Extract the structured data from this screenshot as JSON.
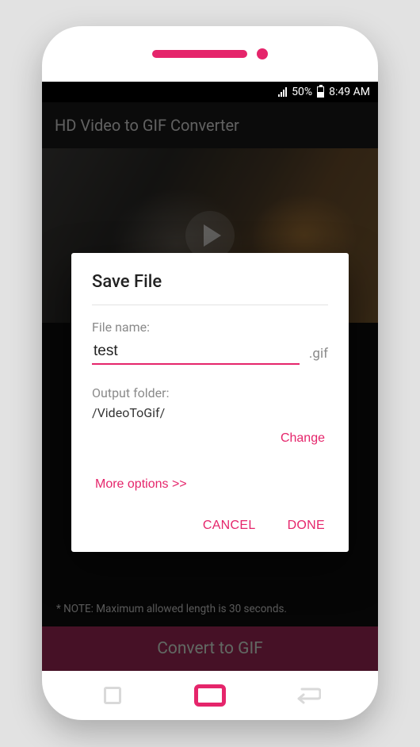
{
  "statusbar": {
    "battery": "50%",
    "time": "8:49 AM"
  },
  "appbar": {
    "title": "HD Video to GIF Converter"
  },
  "note": "* NOTE: Maximum allowed length is 30 seconds.",
  "convert_button": "Convert to GIF",
  "dialog": {
    "title": "Save File",
    "filename_label": "File name:",
    "filename_value": "test",
    "extension": ".gif",
    "output_label": "Output folder:",
    "output_path": "/VideoToGif/",
    "change": "Change",
    "more_options": "More options >>",
    "cancel": "CANCEL",
    "done": "DONE"
  },
  "accent": "#e5256b"
}
